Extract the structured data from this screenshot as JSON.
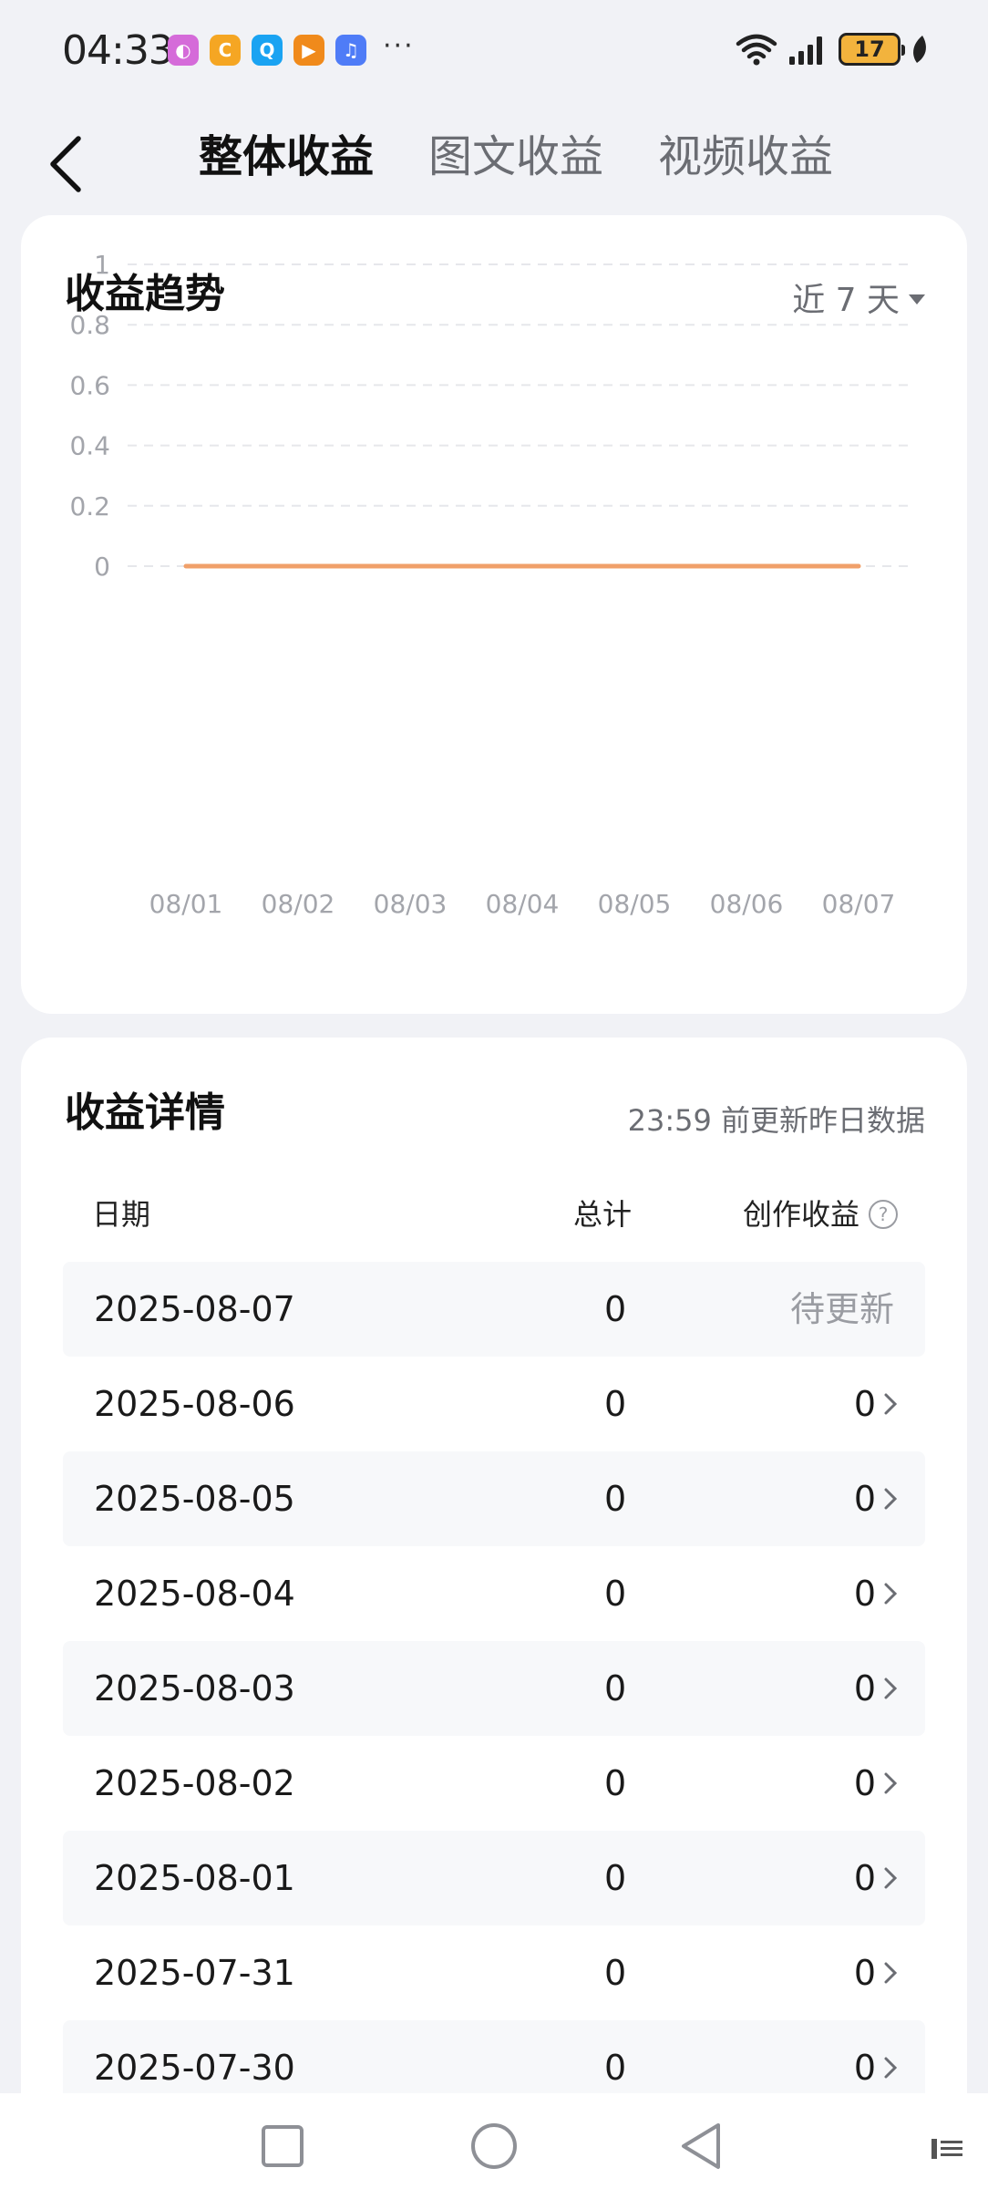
{
  "status_bar": {
    "time": "04:33",
    "battery": "17",
    "notif_more": "···",
    "notification_icons": [
      {
        "name": "app-avatar-icon",
        "color": "#d56bd9",
        "glyph": "◐"
      },
      {
        "name": "app-circle-icon",
        "color": "#f5a623",
        "glyph": "C"
      },
      {
        "name": "app-search-icon",
        "color": "#1aa3f2",
        "glyph": "Q"
      },
      {
        "name": "app-play-icon",
        "color": "#f08a1b",
        "glyph": "▶"
      },
      {
        "name": "app-music-icon",
        "color": "#4f7cf7",
        "glyph": "♫"
      }
    ]
  },
  "header": {
    "tabs": [
      {
        "label": "整体收益",
        "active": true
      },
      {
        "label": "图文收益",
        "active": false
      },
      {
        "label": "视频收益",
        "active": false
      }
    ]
  },
  "trend": {
    "title": "收益趋势",
    "range_label": "近 7 天"
  },
  "chart_data": {
    "type": "line",
    "title": "",
    "categories": [
      "08/01",
      "08/02",
      "08/03",
      "08/04",
      "08/05",
      "08/06",
      "08/07"
    ],
    "series": [
      {
        "values": [
          0,
          0,
          0,
          0,
          0,
          0,
          0
        ],
        "color": "#f0a06a"
      }
    ],
    "y_ticks": [
      "1",
      "0.8",
      "0.6",
      "0.4",
      "0.2",
      "0"
    ],
    "ylim": [
      0,
      1
    ],
    "grid": "dashed horizontal",
    "xlabel": "",
    "ylabel": ""
  },
  "detail": {
    "title": "收益详情",
    "update_note": "23:59 前更新昨日数据",
    "columns": {
      "date": "日期",
      "total": "总计",
      "earnings": "创作收益"
    },
    "help_glyph": "?",
    "rows": [
      {
        "date": "2025-08-07",
        "total": "0",
        "earnings": "待更新",
        "pending": true
      },
      {
        "date": "2025-08-06",
        "total": "0",
        "earnings": "0",
        "pending": false
      },
      {
        "date": "2025-08-05",
        "total": "0",
        "earnings": "0",
        "pending": false
      },
      {
        "date": "2025-08-04",
        "total": "0",
        "earnings": "0",
        "pending": false
      },
      {
        "date": "2025-08-03",
        "total": "0",
        "earnings": "0",
        "pending": false
      },
      {
        "date": "2025-08-02",
        "total": "0",
        "earnings": "0",
        "pending": false
      },
      {
        "date": "2025-08-01",
        "total": "0",
        "earnings": "0",
        "pending": false
      },
      {
        "date": "2025-07-31",
        "total": "0",
        "earnings": "0",
        "pending": false
      },
      {
        "date": "2025-07-30",
        "total": "0",
        "earnings": "0",
        "pending": false
      }
    ]
  }
}
